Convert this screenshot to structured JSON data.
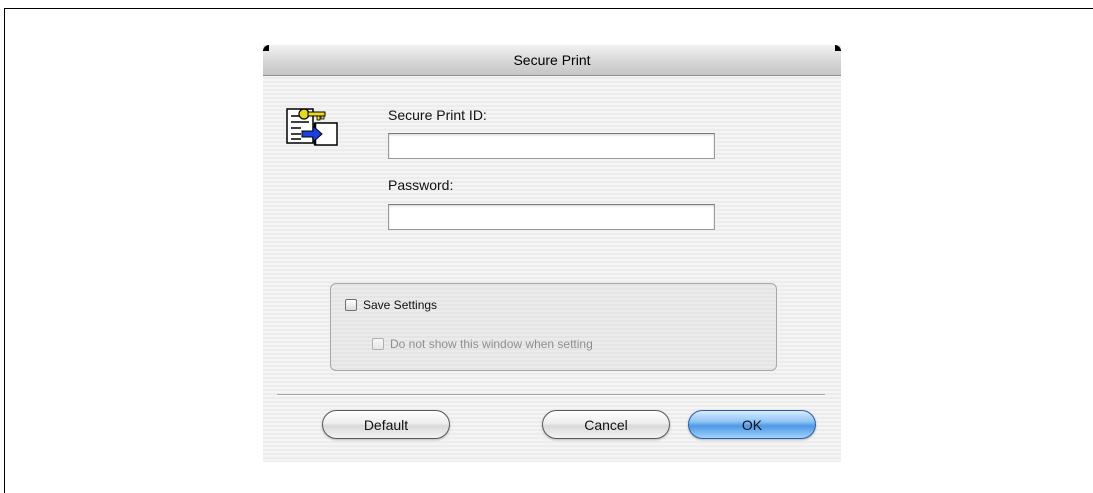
{
  "dialog": {
    "title": "Secure Print",
    "icon": "secure-print-key-document-icon",
    "secure_print_id": {
      "label": "Secure Print ID:",
      "value": ""
    },
    "password": {
      "label": "Password:",
      "value": ""
    },
    "save_settings": {
      "label": "Save Settings",
      "checked": false,
      "enabled": true
    },
    "do_not_show": {
      "label": "Do not show this window when setting",
      "checked": false,
      "enabled": false
    },
    "buttons": {
      "default": "Default",
      "cancel": "Cancel",
      "ok": "OK"
    }
  },
  "colors": {
    "ok_button": "#4c98e6",
    "dialog_bg": "#ececec",
    "titlebar": "#d6d6d6"
  }
}
